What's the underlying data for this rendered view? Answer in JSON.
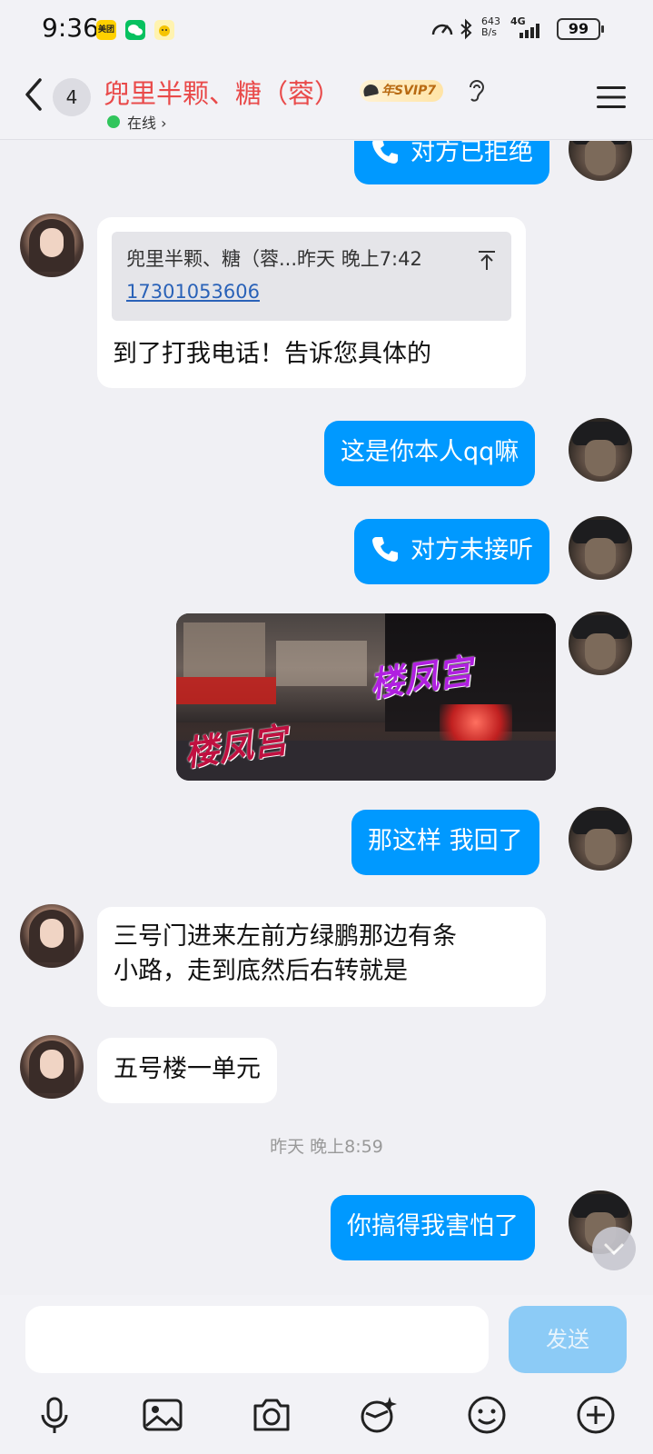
{
  "status_bar": {
    "time": "9:36",
    "app_icons": [
      "meituan-icon",
      "wechat-icon",
      "yellow-app-icon"
    ],
    "app1_text": "美团",
    "net_speed_top": "643",
    "net_speed_bottom": "B/s",
    "network": "4G",
    "battery": "99"
  },
  "header": {
    "unread_count": "4",
    "contact_name": "兜里半颗、糖（蓉）",
    "badge": "年SVIP7",
    "online_status": "在线",
    "chevron": "›"
  },
  "messages": [
    {
      "side": "out",
      "type": "call",
      "text": "对方已拒绝"
    },
    {
      "side": "in",
      "type": "quote",
      "quote_meta": "兜里半颗、糖（蓉...昨天 晚上7:42",
      "quote_phone": "17301053606",
      "text": "到了打我电话！告诉您具体的"
    },
    {
      "side": "out",
      "type": "text",
      "text": "这是你本人qq嘛"
    },
    {
      "side": "out",
      "type": "call",
      "text": "对方未接听"
    },
    {
      "side": "out",
      "type": "image",
      "watermark_1": "楼凤宫",
      "watermark_2": "楼凤宫"
    },
    {
      "side": "out",
      "type": "text",
      "text": "那这样 我回了"
    },
    {
      "side": "in",
      "type": "text",
      "line1": "三号门进来左前方绿鹏那边有条",
      "line2": "小路，走到底然后右转就是"
    },
    {
      "side": "in",
      "type": "text",
      "text": "五号楼一单元"
    },
    {
      "side": "out",
      "type": "text",
      "text": "你搞得我害怕了"
    }
  ],
  "timestamp": "昨天 晚上8:59",
  "input": {
    "placeholder": "",
    "send_label": "发送"
  },
  "toolbar": [
    "microphone-icon",
    "image-icon",
    "camera-icon",
    "sticker-icon",
    "emoji-icon",
    "plus-icon"
  ],
  "colors": {
    "outgoing_bubble": "#0099ff",
    "incoming_bubble": "#ffffff",
    "name": "#e94a4a",
    "online": "#31c55c",
    "send_disabled": "#8ccbf6"
  }
}
